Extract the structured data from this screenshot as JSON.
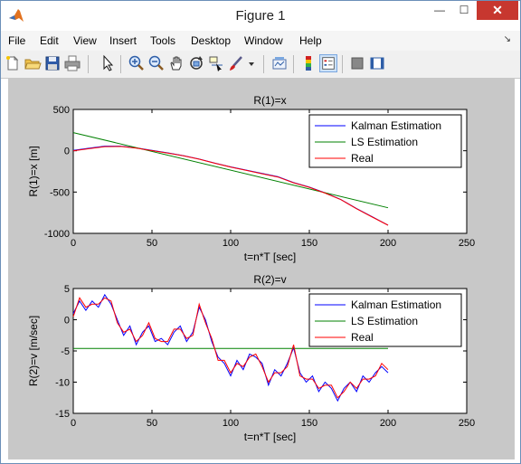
{
  "window": {
    "title": "Figure 1",
    "close_glyph": "✕",
    "min_glyph": "—",
    "max_glyph": "☐"
  },
  "menu": {
    "items": [
      "File",
      "Edit",
      "View",
      "Insert",
      "Tools",
      "Desktop",
      "Window",
      "Help"
    ],
    "dock_glyph": "↘"
  },
  "toolbar": {
    "icons": [
      "new-figure-icon",
      "open-file-icon",
      "save-figure-icon",
      "print-figure-icon",
      "edit-plot-arrow-icon",
      "zoom-in-icon",
      "zoom-out-icon",
      "pan-hand-icon",
      "rotate-3d-icon",
      "data-cursor-icon",
      "brush-icon",
      "brush-dropdown-icon",
      "link-plot-icon",
      "insert-colorbar-icon",
      "insert-legend-icon",
      "hide-plot-tools-icon",
      "show-plot-tools-icon"
    ]
  },
  "colors": {
    "kalman": "#0000ff",
    "ls": "#008000",
    "real": "#ff0000",
    "axes_bg": "#ffffff",
    "figure_bg": "#c8c8c8"
  },
  "chart_data": [
    {
      "type": "line",
      "title": "R(1)=x",
      "xlabel": "t=n*T [sec]",
      "ylabel": "R(1)=x [m]",
      "xlim": [
        0,
        250
      ],
      "ylim": [
        -1000,
        500
      ],
      "xticks": [
        "0",
        "50",
        "100",
        "150",
        "200",
        "250"
      ],
      "yticks": [
        "500",
        "0",
        "-500",
        "-1000"
      ],
      "grid": false,
      "legend": {
        "position": "top-right",
        "entries": [
          "Kalman Estimation",
          "LS Estimation",
          "Real"
        ]
      },
      "series": [
        {
          "name": "Kalman Estimation",
          "color": "blue",
          "x": [
            0,
            10,
            20,
            30,
            40,
            50,
            60,
            70,
            80,
            90,
            100,
            110,
            120,
            130,
            140,
            150,
            160,
            170,
            180,
            190,
            200
          ],
          "y": [
            5,
            30,
            55,
            55,
            35,
            5,
            -25,
            -60,
            -100,
            -150,
            -195,
            -235,
            -275,
            -315,
            -385,
            -440,
            -510,
            -590,
            -700,
            -800,
            -900
          ]
        },
        {
          "name": "LS Estimation",
          "color": "green",
          "x": [
            0,
            200
          ],
          "y": [
            220,
            -690
          ]
        },
        {
          "name": "Real",
          "color": "red",
          "x": [
            0,
            10,
            20,
            30,
            40,
            50,
            60,
            70,
            80,
            90,
            100,
            110,
            120,
            130,
            140,
            150,
            160,
            170,
            180,
            190,
            200
          ],
          "y": [
            0,
            25,
            50,
            52,
            32,
            2,
            -28,
            -62,
            -102,
            -152,
            -197,
            -238,
            -278,
            -318,
            -388,
            -443,
            -513,
            -592,
            -702,
            -803,
            -902
          ]
        }
      ]
    },
    {
      "type": "line",
      "title": "R(2)=v",
      "xlabel": "t=n*T [sec]",
      "ylabel": "R(2)=v [m/sec]",
      "xlim": [
        0,
        250
      ],
      "ylim": [
        -15,
        5
      ],
      "xticks": [
        "0",
        "50",
        "100",
        "150",
        "200",
        "250"
      ],
      "yticks": [
        "5",
        "0",
        "-5",
        "-10",
        "-15"
      ],
      "grid": false,
      "legend": {
        "position": "top-right",
        "entries": [
          "Kalman Estimation",
          "LS Estimation",
          "Real"
        ]
      },
      "series": [
        {
          "name": "Kalman Estimation",
          "color": "blue",
          "x": [
            0,
            4,
            8,
            12,
            16,
            20,
            24,
            28,
            32,
            36,
            40,
            44,
            48,
            52,
            56,
            60,
            64,
            68,
            72,
            76,
            80,
            84,
            88,
            92,
            96,
            100,
            104,
            108,
            112,
            116,
            120,
            124,
            128,
            132,
            136,
            140,
            144,
            148,
            152,
            156,
            160,
            164,
            168,
            172,
            176,
            180,
            184,
            188,
            192,
            196,
            200
          ],
          "y": [
            1,
            3,
            1.5,
            3,
            2,
            4,
            2.5,
            0,
            -2.5,
            -1,
            -4,
            -2,
            -1,
            -3.5,
            -3,
            -4,
            -2,
            -1,
            -3.5,
            -2,
            2,
            0,
            -3.5,
            -6,
            -7,
            -9,
            -6.5,
            -8,
            -5.5,
            -6,
            -7,
            -10.5,
            -8,
            -9,
            -7,
            -4.5,
            -8.5,
            -10,
            -9,
            -11.5,
            -10,
            -11,
            -13,
            -11,
            -10,
            -11.5,
            -9,
            -10,
            -8.5,
            -7.5,
            -8.5
          ]
        },
        {
          "name": "LS Estimation",
          "color": "green",
          "x": [
            0,
            200
          ],
          "y": [
            -4.6,
            -4.6
          ]
        },
        {
          "name": "Real",
          "color": "red",
          "x": [
            0,
            4,
            8,
            12,
            16,
            20,
            24,
            28,
            32,
            36,
            40,
            44,
            48,
            52,
            56,
            60,
            64,
            68,
            72,
            76,
            80,
            84,
            88,
            92,
            96,
            100,
            104,
            108,
            112,
            116,
            120,
            124,
            128,
            132,
            136,
            140,
            144,
            148,
            152,
            156,
            160,
            164,
            168,
            172,
            176,
            180,
            184,
            188,
            192,
            196,
            200
          ],
          "y": [
            0.5,
            3.5,
            2,
            2.5,
            2.5,
            3.5,
            3,
            -0.5,
            -2,
            -1.5,
            -3.5,
            -2.5,
            -0.5,
            -3,
            -3.5,
            -3.5,
            -1.5,
            -1.5,
            -3,
            -2.5,
            2.5,
            -0.5,
            -3,
            -6.5,
            -6.5,
            -8.5,
            -7,
            -7.5,
            -6,
            -5.5,
            -7.5,
            -10,
            -8.5,
            -8.5,
            -7.5,
            -4,
            -9,
            -9.5,
            -9.5,
            -11,
            -10.5,
            -10.5,
            -12.5,
            -11.5,
            -10,
            -11,
            -9.5,
            -9.5,
            -9,
            -7,
            -8
          ]
        }
      ]
    }
  ]
}
